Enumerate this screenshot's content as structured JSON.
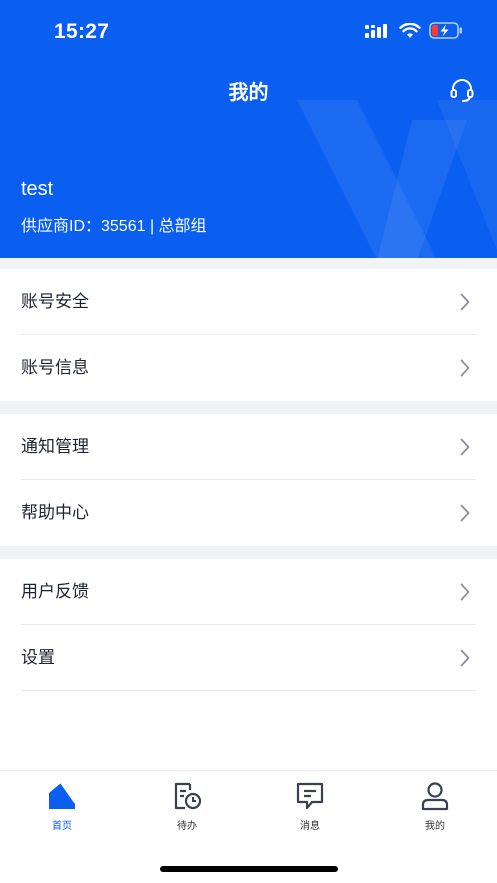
{
  "status_bar": {
    "time": "15:27"
  },
  "header": {
    "title": "我的",
    "user_name": "test",
    "supplier_line": "供应商ID：35561 | 总部组"
  },
  "menu": [
    {
      "label": "账号安全"
    },
    {
      "label": "账号信息"
    },
    {
      "label": "通知管理"
    },
    {
      "label": "帮助中心"
    },
    {
      "label": "用户反馈"
    },
    {
      "label": "设置"
    }
  ],
  "tabbar": [
    {
      "label": "首页",
      "icon": "home-icon",
      "active": true
    },
    {
      "label": "待办",
      "icon": "todo-clock-icon",
      "active": false
    },
    {
      "label": "消息",
      "icon": "message-icon",
      "active": false
    },
    {
      "label": "我的",
      "icon": "user-icon",
      "active": false
    }
  ],
  "colors": {
    "brand": "#0a5ff0",
    "background_gap": "#f2f3f5",
    "text": "#1f2330"
  }
}
